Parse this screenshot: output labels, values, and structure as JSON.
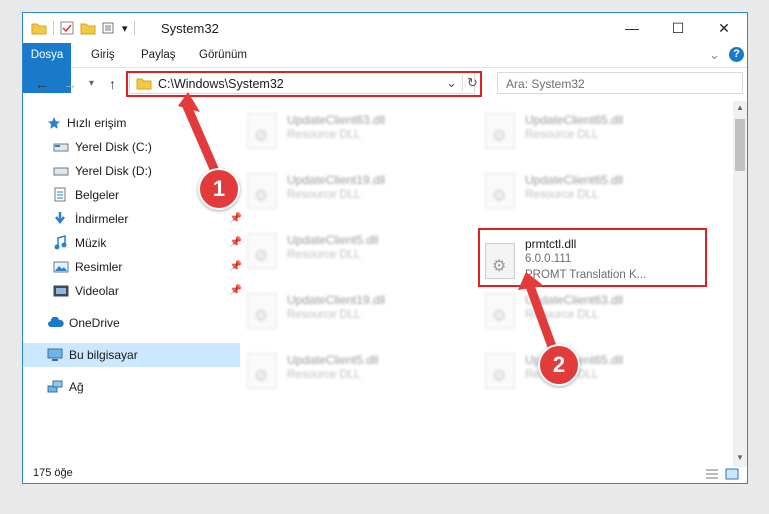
{
  "window": {
    "title": "System32",
    "quick_access_dropdown": "▾",
    "minimize": "—",
    "maximize": "☐",
    "close": "✕"
  },
  "ribbon": {
    "tabs": [
      "Dosya",
      "Giriş",
      "Paylaş",
      "Görünüm"
    ],
    "expand_icon": "⌄",
    "help_icon": "?"
  },
  "navigation": {
    "address": "C:\\Windows\\System32",
    "search_placeholder": "Ara: System32",
    "back": "←",
    "forward": "→",
    "recent": "▾",
    "up": "↑",
    "dropdown": "⌄",
    "refresh": "↻"
  },
  "sidebar": {
    "items": [
      {
        "label": "Hızlı erişim",
        "icon": "star-icon"
      },
      {
        "label": "Yerel Disk (C:)",
        "icon": "drive-icon"
      },
      {
        "label": "Yerel Disk (D:)",
        "icon": "drive-icon"
      },
      {
        "label": "Belgeler",
        "icon": "documents-icon"
      },
      {
        "label": "İndirmeler",
        "icon": "download-icon"
      },
      {
        "label": "Müzik",
        "icon": "music-icon"
      },
      {
        "label": "Resimler",
        "icon": "pictures-icon"
      },
      {
        "label": "Videolar",
        "icon": "videos-icon"
      },
      {
        "label": "OneDrive",
        "icon": "cloud-icon"
      },
      {
        "label": "Bu bilgisayar",
        "icon": "computer-icon"
      },
      {
        "label": "Ağ",
        "icon": "network-icon"
      }
    ]
  },
  "files": [
    {
      "name": "UpdateClient63.dll",
      "type": "Resource DLL"
    },
    {
      "name": "UpdateClient65.dll",
      "type": "Resource DLL"
    },
    {
      "name": "UpdateClient19.dll",
      "type": "Resource DLL"
    },
    {
      "name": "UpdateClient65.dll",
      "type": "Resource DLL"
    },
    {
      "name": "UpdateClient5.dll",
      "type": "Resource DLL"
    },
    {
      "name": "prmtctl.dll",
      "version": "6.0.0.111",
      "type": "PROMT Translation K..."
    },
    {
      "name": "UpdateClient19.dll",
      "type": "Resource DLL"
    },
    {
      "name": "UpdateClient63.dll",
      "type": "Resource DLL"
    },
    {
      "name": "UpdateClient5.dll",
      "type": "Resource DLL"
    },
    {
      "name": "UpdateClient65.dll",
      "type": "Resource DLL"
    }
  ],
  "status": {
    "count": "175 öğe"
  },
  "annotations": [
    {
      "label": "1",
      "color": "#e23b3b"
    },
    {
      "label": "2",
      "color": "#e23b3b"
    }
  ]
}
